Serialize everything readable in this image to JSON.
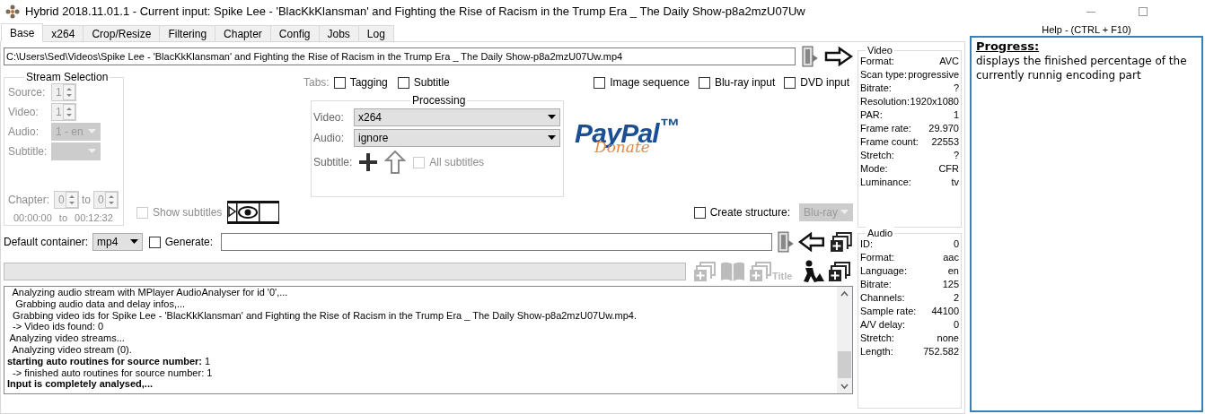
{
  "window": {
    "title": "Hybrid 2018.11.01.1 - Current input: Spike Lee - 'BlacKkKlansman' and Fighting the Rise of Racism in the Trump Era _ The Daily Show-p8a2mzU07Uw"
  },
  "tabs": [
    {
      "label": "Base",
      "selected": true
    },
    {
      "label": "x264",
      "selected": false
    },
    {
      "label": "Crop/Resize",
      "selected": false
    },
    {
      "label": "Filtering",
      "selected": false
    },
    {
      "label": "Chapter",
      "selected": false
    },
    {
      "label": "Config",
      "selected": false
    },
    {
      "label": "Jobs",
      "selected": false
    },
    {
      "label": "Log",
      "selected": false
    }
  ],
  "input_path": "C:\\Users\\Sed\\Videos\\Spike Lee - 'BlacKkKlansman' and Fighting the Rise of Racism in the Trump Era _ The Daily Show-p8a2mzU07Uw.mp4",
  "stream_selection": {
    "title": "Stream Selection",
    "disabled": true,
    "fields": [
      {
        "label": "Source:",
        "value": "1",
        "kind": "spinner"
      },
      {
        "label": "Video:",
        "value": "1",
        "kind": "spinner"
      },
      {
        "label": "Audio:",
        "value": "1 - en",
        "kind": "dropdown"
      },
      {
        "label": "Subtitle:",
        "kind": "dropdown"
      }
    ],
    "chapter": {
      "label": "Chapter:",
      "from": "0",
      "to_label": "to",
      "to": "0",
      "time_from": "00:00:00",
      "time_to_label": "to",
      "time_to": "00:12:32"
    }
  },
  "tab_options": {
    "label": "Tabs:",
    "options": [
      {
        "label": "Tagging",
        "checked": false
      },
      {
        "label": "Subtitle",
        "checked": false
      }
    ]
  },
  "input_options": [
    {
      "label": "Image sequence",
      "checked": false
    },
    {
      "label": "Blu-ray input",
      "checked": false
    },
    {
      "label": "DVD input",
      "checked": false
    }
  ],
  "processing": {
    "title": "Processing",
    "video": {
      "label": "Video:",
      "value": "x264"
    },
    "audio": {
      "label": "Audio:",
      "value": "ignore"
    },
    "subtitle_label": "Subtitle:",
    "all_subtitles": {
      "label": "All subtitles",
      "checked": false,
      "disabled": true
    }
  },
  "donate": {
    "brand": "PayPal$^{™}$",
    "action": "Donate"
  },
  "show_subtitles": {
    "label": "Show subtitles",
    "checked": false,
    "disabled": true
  },
  "create_structure": {
    "label": "Create structure:",
    "checked": false,
    "value": "Blu-ray",
    "disabled": true
  },
  "default_container": {
    "label": "Default container:",
    "value": "mp4"
  },
  "generate": {
    "label": "Generate:",
    "checked": false
  },
  "progress": {
    "level": 0
  },
  "title_button": "Title",
  "log": [
    {
      "text": "  Analyzing audio stream with MPlayer AudioAnalyser for id '0',...",
      "bold": false
    },
    {
      "text": "   Grabbing audio data and delay infos,...",
      "bold": false
    },
    {
      "text": "  Grabbing video ids for Spike Lee - 'BlacKkKlansman' and Fighting the Rise of Racism in the Trump Era _ The Daily Show-p8a2mzU07Uw.mp4.",
      "bold": false
    },
    {
      "text": "  -> Video ids found: 0",
      "bold": false
    },
    {
      "text": " Analyzing video streams...",
      "bold": false
    },
    {
      "text": "  Analyzing video stream (0).",
      "bold": false
    },
    {
      "text": "**starting auto routines for source number:** 1",
      "bold": false
    },
    {
      "text": "  -> finished auto routines for source number: 1",
      "bold": false
    },
    {
      "text": "Input is completely analysed,...",
      "bold": true
    }
  ],
  "video_info": {
    "title": "Video",
    "rows": [
      {
        "label": "Format:",
        "value": "AVC"
      },
      {
        "label": "Scan type:",
        "value": "progressive"
      },
      {
        "label": "Bitrate:",
        "value": "?"
      },
      {
        "label": "Resolution:",
        "value": "1920x1080"
      },
      {
        "label": "PAR:",
        "value": "1"
      },
      {
        "label": "Frame rate:",
        "value": "29.970"
      },
      {
        "label": "Frame count:",
        "value": "22553"
      },
      {
        "label": "Stretch:",
        "value": "?"
      },
      {
        "label": "Mode:",
        "value": "CFR"
      },
      {
        "label": "Luminance:",
        "value": "tv"
      }
    ]
  },
  "audio_info": {
    "title": "Audio",
    "rows": [
      {
        "label": "ID:",
        "value": "0"
      },
      {
        "label": "Format:",
        "value": "aac"
      },
      {
        "label": "Language:",
        "value": "en"
      },
      {
        "label": "Bitrate:",
        "value": "125"
      },
      {
        "label": "Channels:",
        "value": "2"
      },
      {
        "label": "Sample rate:",
        "value": "44100"
      },
      {
        "label": "A/V delay:",
        "value": "0"
      },
      {
        "label": "Stretch:",
        "value": "none"
      },
      {
        "label": "Length:",
        "value": "752.582"
      }
    ]
  },
  "help": {
    "title": "Help - (CTRL + F10)",
    "heading": "Progress:",
    "text": "displays the finished percentage of the currently runnig encoding part"
  }
}
